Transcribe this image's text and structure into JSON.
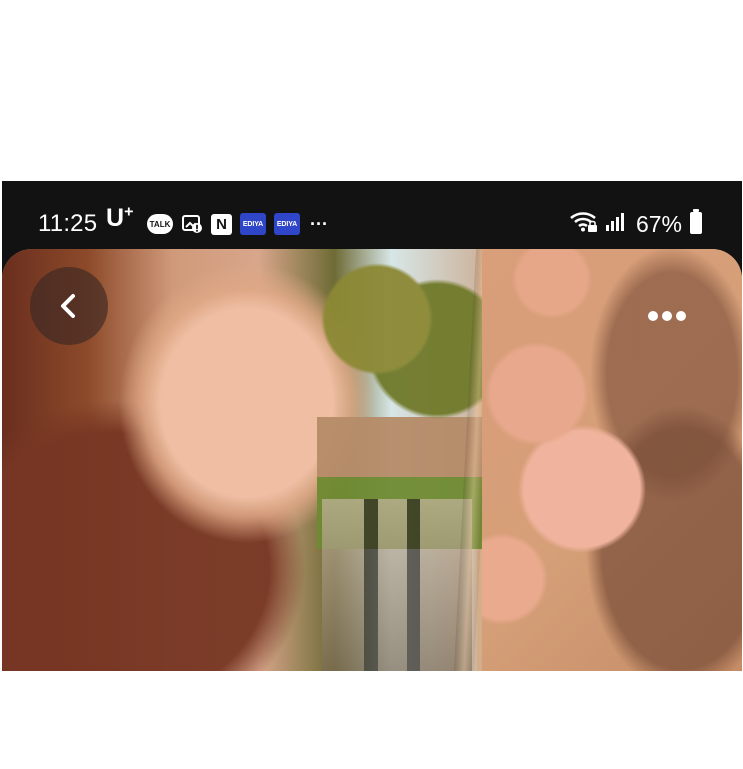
{
  "status_bar": {
    "time": "11:25",
    "carrier": "U",
    "carrier_superscript": "+",
    "notification_labels": {
      "talk": "TALK",
      "naver": "N",
      "ediya_1": "EDIYA",
      "ediya_2": "EDIYA",
      "more": "···"
    },
    "battery_percent": "67%"
  },
  "icons": {
    "back": "chevron-left-icon",
    "more": "more-horizontal-icon",
    "wifi": "wifi-icon",
    "signal": "signal-icon",
    "battery": "battery-icon"
  },
  "colors": {
    "status_bar": "#121212",
    "ediya": "#3046c8",
    "icon_white": "#ffffff"
  }
}
